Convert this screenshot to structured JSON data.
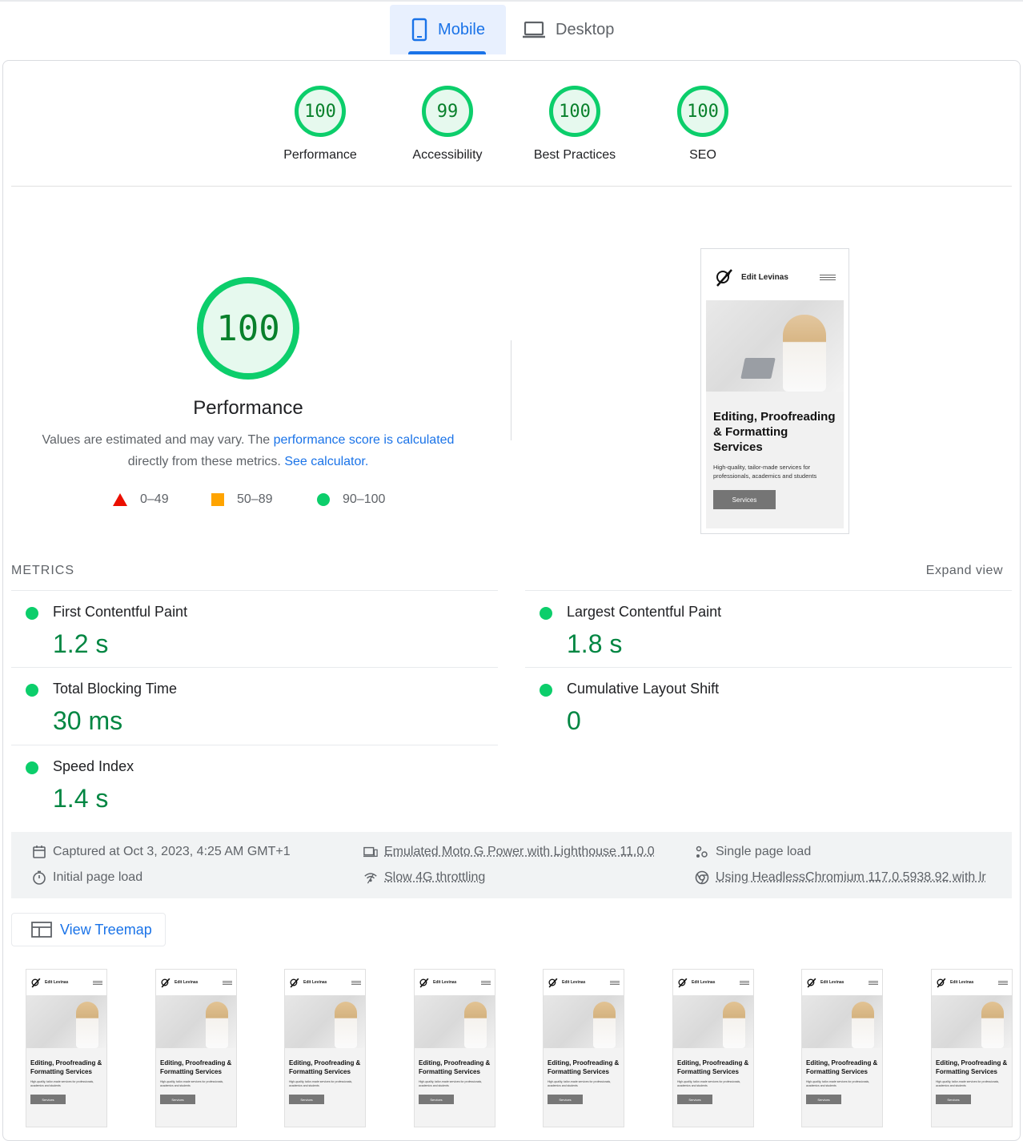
{
  "tabs": {
    "mobile_label": "Mobile",
    "desktop_label": "Desktop"
  },
  "categories": [
    {
      "score": "100",
      "label": "Performance"
    },
    {
      "score": "99",
      "label": "Accessibility"
    },
    {
      "score": "100",
      "label": "Best Practices"
    },
    {
      "score": "100",
      "label": "SEO"
    }
  ],
  "performance": {
    "score": "100",
    "title": "Performance",
    "desc_prefix": "Values are estimated and may vary. The ",
    "desc_link": "performance score is calculated",
    "desc_middle": " directly from these metrics. ",
    "desc_calc_link": "See calculator.",
    "legend": {
      "fail": "0–49",
      "average": "50–89",
      "pass": "90–100"
    },
    "colors": {
      "pass": "#0cce6b",
      "average": "#ffa400",
      "fail": "#eb0f00",
      "link": "#1a73e8"
    }
  },
  "preview": {
    "brand": "Edit Levinas",
    "headline": "Editing, Proofreading & Formatting Services",
    "subtext": "High-quality, tailor-made services for professionals, academics and students",
    "button": "Services"
  },
  "metrics": {
    "title": "METRICS",
    "expand": "Expand view",
    "items": [
      {
        "name": "First Contentful Paint",
        "value": "1.2 s"
      },
      {
        "name": "Largest Contentful Paint",
        "value": "1.8 s"
      },
      {
        "name": "Total Blocking Time",
        "value": "30 ms"
      },
      {
        "name": "Cumulative Layout Shift",
        "value": "0"
      },
      {
        "name": "Speed Index",
        "value": "1.4 s"
      }
    ]
  },
  "run_info": {
    "captured": "Captured at Oct 3, 2023, 4:25 AM GMT+1",
    "initial_load": "Initial page load",
    "device": "Emulated Moto G Power with Lighthouse 11.0.0",
    "throttling": "Slow 4G throttling",
    "single_load": "Single page load",
    "browser": "Using HeadlessChromium 117.0.5938.92 with lr"
  },
  "treemap": {
    "label": "View Treemap"
  },
  "filmstrip": {
    "brand": "Edit Levinas",
    "headline": "Editing, Proofreading & Formatting Services",
    "subtext": "High-quality, tailor-made services for professionals, academics and students",
    "button": "Services",
    "frames": 8
  }
}
